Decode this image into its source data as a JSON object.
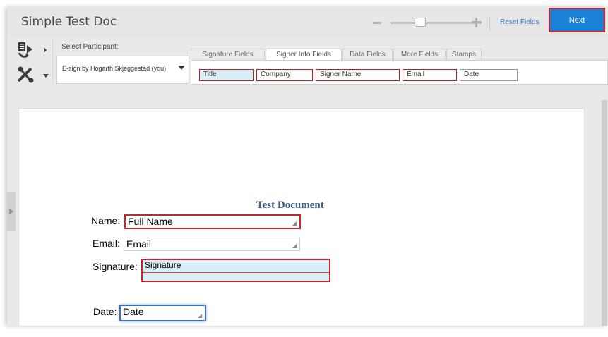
{
  "titlebar": {
    "doc_title": "Simple Test Doc",
    "reset_label": "Reset Fields",
    "next_label": "Next",
    "zoom_level": 0.3
  },
  "toolbar": {
    "tool1_icon": "add-recipient-icon",
    "tool2_icon": "tools-icon",
    "participant_label": "Select Participant:",
    "participant_value": "E-sign by Hogarth Skjeggestad (you)",
    "tabs": [
      {
        "label": "Signature Fields",
        "active": false
      },
      {
        "label": "Signer Info Fields",
        "active": true
      },
      {
        "label": "Data Fields",
        "active": false
      },
      {
        "label": "More Fields",
        "active": false
      },
      {
        "label": "Stamps",
        "active": false
      }
    ],
    "chips": [
      "Title",
      "Company",
      "Signer Name",
      "Email",
      "Date"
    ]
  },
  "document": {
    "heading": "Test Document",
    "rows": [
      {
        "label": "Name:",
        "field": "Full Name"
      },
      {
        "label": "Email:",
        "field": "Email"
      },
      {
        "label": "Signature:",
        "field": "Signature"
      },
      {
        "label": "Date:",
        "field": "Date"
      }
    ]
  },
  "colors": {
    "accent": "#1a82d6",
    "highlight_border": "#c0282d",
    "field_fill": "#d9eff7",
    "heading": "#3a5f8e"
  }
}
